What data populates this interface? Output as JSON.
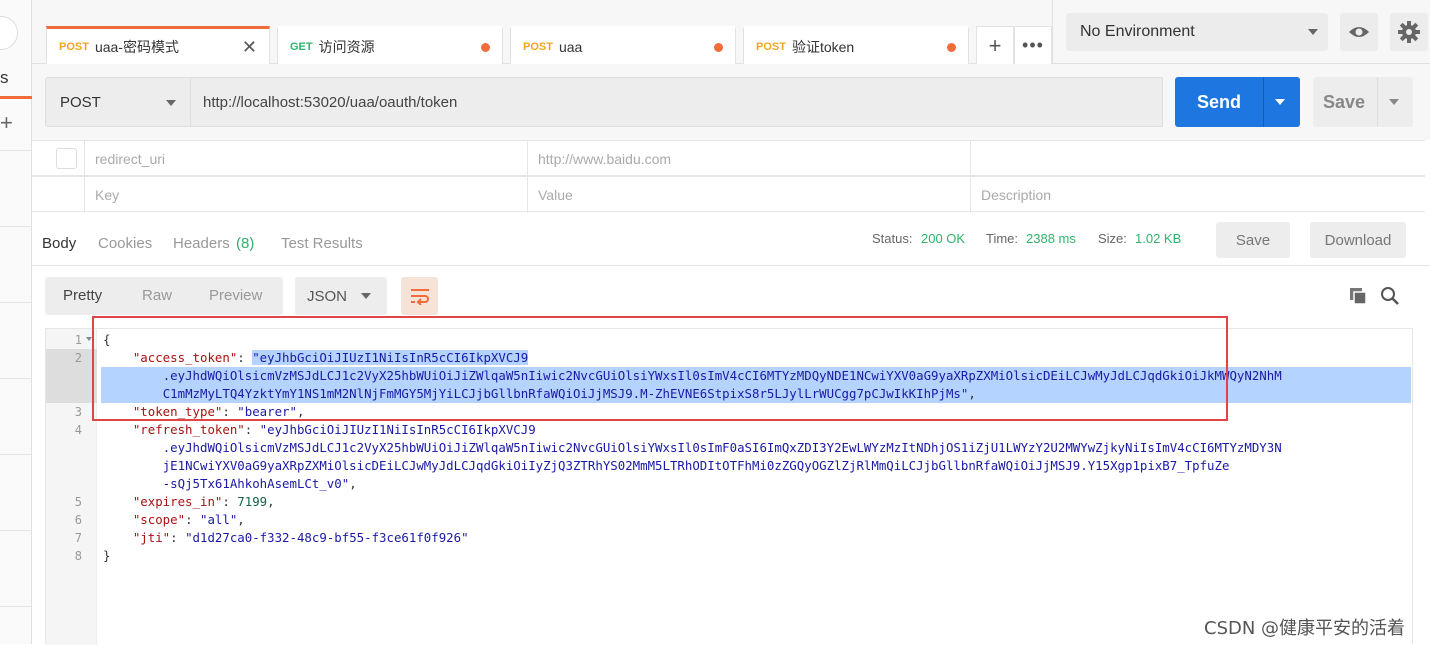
{
  "tabs": [
    {
      "method": "POST",
      "name": "uaa-密码模式",
      "active": true
    },
    {
      "method": "GET",
      "name": "访问资源"
    },
    {
      "method": "POST",
      "name": "uaa"
    },
    {
      "method": "POST",
      "name": "验证token"
    }
  ],
  "left_tab_letter": "s",
  "environment": {
    "selected": "No Environment"
  },
  "request": {
    "method": "POST",
    "url": "http://localhost:53020/uaa/oauth/token",
    "send_label": "Send",
    "save_label": "Save"
  },
  "params": {
    "row": {
      "key": "redirect_uri",
      "value": "http://www.baidu.com"
    },
    "placeholders": {
      "key": "Key",
      "value": "Value",
      "description": "Description"
    }
  },
  "response": {
    "tabs": [
      "Body",
      "Cookies",
      "Headers",
      "(8)",
      "Test Results"
    ],
    "status_label": "Status:",
    "status": "200 OK",
    "time_label": "Time:",
    "time": "2388 ms",
    "size_label": "Size:",
    "size": "1.02 KB",
    "save_label": "Save",
    "download_label": "Download"
  },
  "view": {
    "modes": [
      "Pretty",
      "Raw",
      "Preview"
    ],
    "format": "JSON"
  },
  "code_lines": {
    "l1": "{",
    "l2k": "\"access_token\"",
    "l2v": "\"eyJhbGciOiJIUzI1NiIsInR5cCI6IkpXVCJ9",
    "l2b": ".eyJhdWQiOlsicmVzMSJdLCJ1c2VyX25hbWUiOiJiZWlqaW5nIiwic2NvcGUiOlsiYWxsIl0sImV4cCI6MTYzMDQyNDE1NCwiYXV0aG9yaXRpZXMiOlsicDEiLCJwMyJdLCJqdGkiOiJkMWQyN2NhM",
    "l2c": "C1mMzMyLTQ4YzktYmY1NS1mM2NlNjFmMGY5MjYiLCJjbGllbnRfaWQiOiJjMSJ9.M-ZhEVNE6StpixS8r5LJylLrWUCgg7pCJwIkKIhPjMs\"",
    "l3k": "\"token_type\"",
    "l3v": "\"bearer\"",
    "l4k": "\"refresh_token\"",
    "l4v": "\"eyJhbGciOiJIUzI1NiIsInR5cCI6IkpXVCJ9",
    "l4b": ".eyJhdWQiOlsicmVzMSJdLCJ1c2VyX25hbWUiOiJiZWlqaW5nIiwic2NvcGUiOlsiYWxsIl0sImF0aSI6ImQxZDI3Y2EwLWYzMzItNDhjOS1iZjU1LWYzY2U2MWYwZjkyNiIsImV4cCI6MTYzMDY3N",
    "l4c": "jE1NCwiYXV0aG9yaXRpZXMiOlsicDEiLCJwMyJdLCJqdGkiOiIyZjQ3ZTRhYS02MmM5LTRhODItOTFhMi0zZGQyOGZlZjRlMmQiLCJjbGllbnRfaWQiOiJjMSJ9.Y15Xgp1pixB7_TpfuZe",
    "l4d": "-sQj5Tx61AhkohAsemLCt_v0\"",
    "l5k": "\"expires_in\"",
    "l5v": "7199",
    "l6k": "\"scope\"",
    "l6v": "\"all\"",
    "l7k": "\"jti\"",
    "l7v": "\"d1d27ca0-f332-48c9-bf55-f3ce61f0f926\"",
    "l8": "}"
  },
  "line_numbers": [
    "1",
    "2",
    "3",
    "4",
    "5",
    "6",
    "7",
    "8"
  ],
  "watermark": "CSDN @健康平安的活着"
}
